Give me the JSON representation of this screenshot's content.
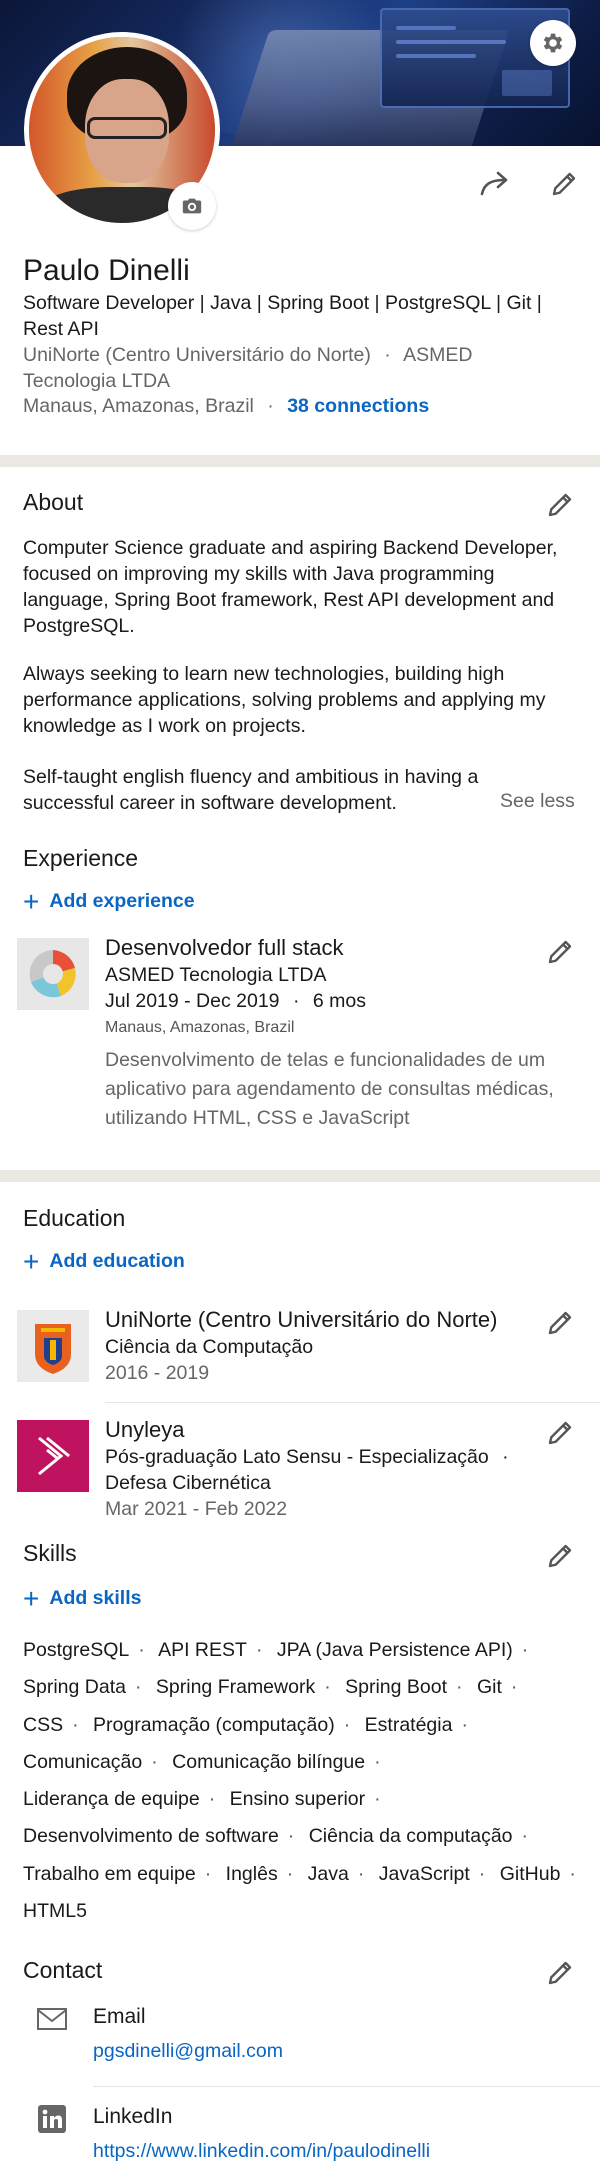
{
  "profile": {
    "name": "Paulo Dinelli",
    "headline": "Software Developer | Java | Spring Boot | PostgreSQL | Git | Rest API",
    "school": "UniNorte (Centro Universitário do Norte)",
    "company": "ASMED Tecnologia LTDA",
    "location": "Manaus, Amazonas, Brazil",
    "connections": "38 connections",
    "separator": "·"
  },
  "about": {
    "title": "About",
    "paragraphs": [
      "Computer Science graduate and aspiring Backend Developer, focused on improving my skills with Java programming language, Spring Boot framework, Rest API development and PostgreSQL.",
      "Always seeking to learn new technologies, building high performance applications, solving problems and applying my knowledge as I work on projects.",
      "Self-taught english fluency and ambitious in having a successful career in software development."
    ],
    "toggle": "See less"
  },
  "experience": {
    "title": "Experience",
    "add_label": "Add experience",
    "items": [
      {
        "title": "Desenvolvedor full stack",
        "company": "ASMED Tecnologia LTDA",
        "dates": "Jul 2019 - Dec 2019",
        "duration": "6 mos",
        "location": "Manaus, Amazonas, Brazil",
        "description": "Desenvolvimento de telas e funcionalidades de um aplicativo para agendamento de consultas médicas, utilizando HTML, CSS e JavaScript"
      }
    ]
  },
  "education": {
    "title": "Education",
    "add_label": "Add education",
    "items": [
      {
        "school": "UniNorte (Centro Universitário do Norte)",
        "degree": "Ciência da Computação",
        "dates": "2016 - 2019"
      },
      {
        "school": "Unyleya",
        "degree_line1": "Pós-graduação Lato Sensu - Especialização",
        "degree_line2": "Defesa Cibernética",
        "dates": "Mar 2021 - Feb 2022"
      }
    ]
  },
  "skills": {
    "title": "Skills",
    "add_label": "Add skills",
    "items": [
      "PostgreSQL",
      "API REST",
      "JPA (Java Persistence API)",
      "Spring Data",
      "Spring Framework",
      "Spring Boot",
      "Git",
      "CSS",
      "Programação (computação)",
      "Estratégia",
      "Comunicação",
      "Comunicação bilíngue",
      "Liderança de equipe",
      "Ensino superior",
      "Desenvolvimento de software",
      "Ciência da computação",
      "Trabalho em equipe",
      "Inglês",
      "Java",
      "JavaScript",
      "GitHub",
      "HTML5"
    ]
  },
  "contact": {
    "title": "Contact",
    "email_label": "Email",
    "email": "pgsdinelli@gmail.com",
    "linkedin_label": "LinkedIn",
    "linkedin_url": "https://www.linkedin.com/in/paulodinelli"
  },
  "icons": {
    "settings": "gear-icon",
    "camera": "camera-icon",
    "share": "share-arrow-icon",
    "edit": "pencil-icon",
    "add": "plus-icon",
    "email": "envelope-icon",
    "linkedin": "linkedin-icon"
  },
  "colors": {
    "accent": "#0a66c2",
    "divider": "#ebe8e2",
    "muted_text": "#666666"
  }
}
